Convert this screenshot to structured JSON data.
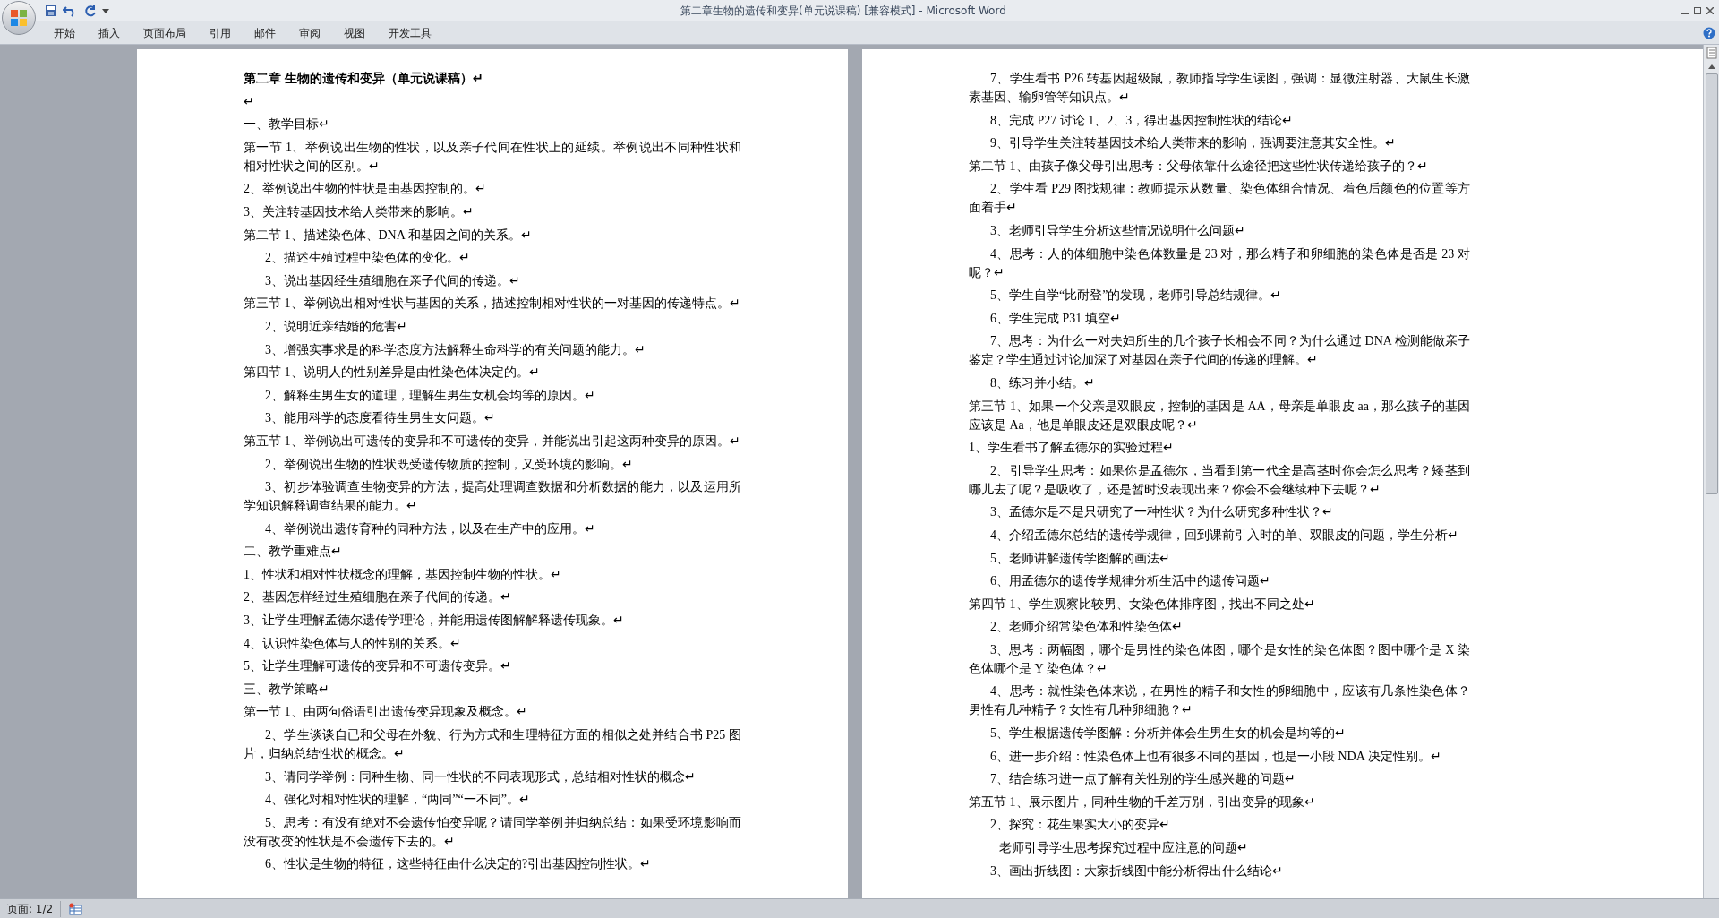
{
  "window": {
    "title": "第二章生物的遗传和变异(单元说课稿) [兼容模式] - Microsoft Word"
  },
  "ribbon_tabs": [
    {
      "label": "开始",
      "selected": false
    },
    {
      "label": "插入",
      "selected": false
    },
    {
      "label": "页面布局",
      "selected": false
    },
    {
      "label": "引用",
      "selected": false
    },
    {
      "label": "邮件",
      "selected": false
    },
    {
      "label": "审阅",
      "selected": false
    },
    {
      "label": "视图",
      "selected": false
    },
    {
      "label": "开发工具",
      "selected": false
    }
  ],
  "pages": [
    {
      "paragraphs": [
        {
          "kind": "title",
          "text": "第二章 生物的遗传和变异（单元说课稿）↵"
        },
        {
          "kind": "flush",
          "text": "↵"
        },
        {
          "kind": "flush",
          "text": "一、教学目标↵"
        },
        {
          "kind": "flush",
          "text": "第一节 1、举例说出生物的性状，以及亲子代间在性状上的延续。举例说出不同种性状和相对性状之间的区别。↵"
        },
        {
          "kind": "flush",
          "text": "2、举例说出生物的性状是由基因控制的。↵"
        },
        {
          "kind": "flush",
          "text": "3、关注转基因技术给人类带来的影响。↵"
        },
        {
          "kind": "flush",
          "text": "第二节 1、描述染色体、DNA 和基因之间的关系。↵"
        },
        {
          "kind": "indent",
          "text": "2、描述生殖过程中染色体的变化。↵"
        },
        {
          "kind": "indent",
          "text": "3、说出基因经生殖细胞在亲子代间的传递。↵"
        },
        {
          "kind": "flush",
          "text": "第三节 1、举例说出相对性状与基因的关系，描述控制相对性状的一对基因的传递特点。↵"
        },
        {
          "kind": "indent",
          "text": "2、说明近亲结婚的危害↵"
        },
        {
          "kind": "indent",
          "text": "3、增强实事求是的科学态度方法解释生命科学的有关问题的能力。↵"
        },
        {
          "kind": "flush",
          "text": "第四节 1、说明人的性别差异是由性染色体决定的。↵"
        },
        {
          "kind": "indent",
          "text": "2、解释生男生女的道理，理解生男生女机会均等的原因。↵"
        },
        {
          "kind": "indent",
          "text": "3、能用科学的态度看待生男生女问题。↵"
        },
        {
          "kind": "flush",
          "text": "第五节 1、举例说出可遗传的变异和不可遗传的变异，并能说出引起这两种变异的原因。↵"
        },
        {
          "kind": "indent",
          "text": "2、举例说出生物的性状既受遗传物质的控制，又受环境的影响。↵"
        },
        {
          "kind": "indent",
          "text": "3、初步体验调查生物变异的方法，提高处理调查数据和分析数据的能力，以及运用所学知识解释调查结果的能力。↵"
        },
        {
          "kind": "indent",
          "text": "4、举例说出遗传育种的同种方法，以及在生产中的应用。↵"
        },
        {
          "kind": "flush",
          "text": "二、教学重难点↵"
        },
        {
          "kind": "flush",
          "text": "1、性状和相对性状概念的理解，基因控制生物的性状。↵"
        },
        {
          "kind": "flush",
          "text": "2、基因怎样经过生殖细胞在亲子代间的传递。↵"
        },
        {
          "kind": "flush",
          "text": "3、让学生理解孟德尔遗传学理论，并能用遗传图解解释遗传现象。↵"
        },
        {
          "kind": "flush",
          "text": "4、认识性染色体与人的性别的关系。↵"
        },
        {
          "kind": "flush",
          "text": "5、让学生理解可遗传的变异和不可遗传变异。↵"
        },
        {
          "kind": "flush",
          "text": "三、教学策略↵"
        },
        {
          "kind": "flush",
          "text": "第一节 1、由两句俗语引出遗传变异现象及概念。↵"
        },
        {
          "kind": "indent",
          "text": "2、学生谈谈自已和父母在外貌、行为方式和生理特征方面的相似之处并结合书 P25 图片，归纳总结性状的概念。↵"
        },
        {
          "kind": "indent",
          "text": "3、请同学举例：同种生物、同一性状的不同表现形式，总结相对性状的概念↵"
        },
        {
          "kind": "indent",
          "text": "4、强化对相对性状的理解，“两同”“一不同”。↵"
        },
        {
          "kind": "indent",
          "text": "5、思考：有没有绝对不会遗传怕变异呢？请同学举例并归纳总结：如果受环境影响而没有改变的性状是不会遗传下去的。↵"
        },
        {
          "kind": "indent",
          "text": "6、性状是生物的特征，这些特征由什么决定的?引出基因控制性状。↵"
        }
      ]
    },
    {
      "paragraphs": [
        {
          "kind": "indent",
          "text": "7、学生看书 P26 转基因超级鼠，教师指导学生读图，强调：显微注射器、大鼠生长激素基因、输卵管等知识点。↵"
        },
        {
          "kind": "indent",
          "text": "8、完成 P27 讨论 1、2、3，得出基因控制性状的结论↵"
        },
        {
          "kind": "indent",
          "text": "9、引导学生关注转基因技术给人类带来的影响，强调要注意其安全性。↵"
        },
        {
          "kind": "flush",
          "text": "第二节 1、由孩子像父母引出思考：父母依靠什么途径把这些性状传递给孩子的？↵"
        },
        {
          "kind": "indent",
          "text": "2、学生看 P29 图找规律：教师提示从数量、染色体组合情况、着色后颜色的位置等方面着手↵"
        },
        {
          "kind": "indent",
          "text": "3、老师引导学生分析这些情况说明什么问题↵"
        },
        {
          "kind": "indent",
          "text": "4、思考：人的体细胞中染色体数量是 23 对，那么精子和卵细胞的染色体是否是 23 对呢？↵"
        },
        {
          "kind": "indent",
          "text": "5、学生自学“比耐登”的发现，老师引导总结规律。↵"
        },
        {
          "kind": "indent",
          "text": "6、学生完成 P31 填空↵"
        },
        {
          "kind": "indent",
          "text": "7、思考：为什么一对夫妇所生的几个孩子长相会不同？为什么通过 DNA 检测能做亲子鉴定？学生通过讨论加深了对基因在亲子代间的传递的理解。↵"
        },
        {
          "kind": "indent",
          "text": "8、练习并小结。↵"
        },
        {
          "kind": "flush",
          "text": "第三节  1、如果一个父亲是双眼皮，控制的基因是 AA，母亲是单眼皮 aa，那么孩子的基因应该是 Aa，他是单眼皮还是双眼皮呢？↵"
        },
        {
          "kind": "flush",
          "text": "1、学生看书了解孟德尔的实验过程↵"
        },
        {
          "kind": "indent",
          "text": "2、引导学生思考：如果你是孟德尔，当看到第一代全是高茎时你会怎么思考？矮茎到哪儿去了呢？是吸收了，还是暂时没表现出来？你会不会继续种下去呢？↵"
        },
        {
          "kind": "indent",
          "text": "3、孟德尔是不是只研究了一种性状？为什么研究多种性状？↵"
        },
        {
          "kind": "indent",
          "text": "4、介绍孟德尔总结的遗传学规律，回到课前引入时的单、双眼皮的问题，学生分析↵"
        },
        {
          "kind": "indent",
          "text": "5、老师讲解遗传学图解的画法↵"
        },
        {
          "kind": "indent",
          "text": "6、用孟德尔的遗传学规律分析生活中的遗传问题↵"
        },
        {
          "kind": "flush",
          "text": "第四节 1、学生观察比较男、女染色体排序图，找出不同之处↵"
        },
        {
          "kind": "indent",
          "text": "2、老师介绍常染色体和性染色体↵"
        },
        {
          "kind": "indent",
          "text": "3、思考：两幅图，哪个是男性的染色体图，哪个是女性的染色体图？图中哪个是 X 染色体哪个是 Y 染色体？↵"
        },
        {
          "kind": "indent",
          "text": "4、思考：就性染色体来说，在男性的精子和女性的卵细胞中，应该有几条性染色体？男性有几种精子？女性有几种卵细胞？↵"
        },
        {
          "kind": "indent",
          "text": "5、学生根据遗传学图解：分析并体会生男生女的机会是均等的↵"
        },
        {
          "kind": "indent",
          "text": "6、进一步介绍：性染色体上也有很多不同的基因，也是一小段 NDA 决定性别。↵"
        },
        {
          "kind": "indent",
          "text": "7、结合练习进一点了解有关性别的学生感兴趣的问题↵"
        },
        {
          "kind": "flush",
          "text": "第五节 1、展示图片，同种生物的千差万别，引出变异的现象↵"
        },
        {
          "kind": "indent",
          "text": "2、探究：花生果实大小的变异↵"
        },
        {
          "kind": "deep",
          "text": "老师引导学生思考探究过程中应注意的问题↵"
        },
        {
          "kind": "indent",
          "text": "3、画出折线图：大家折线图中能分析得出什么结论↵"
        }
      ]
    }
  ],
  "status_bar": {
    "page": "页面: 1/2"
  }
}
